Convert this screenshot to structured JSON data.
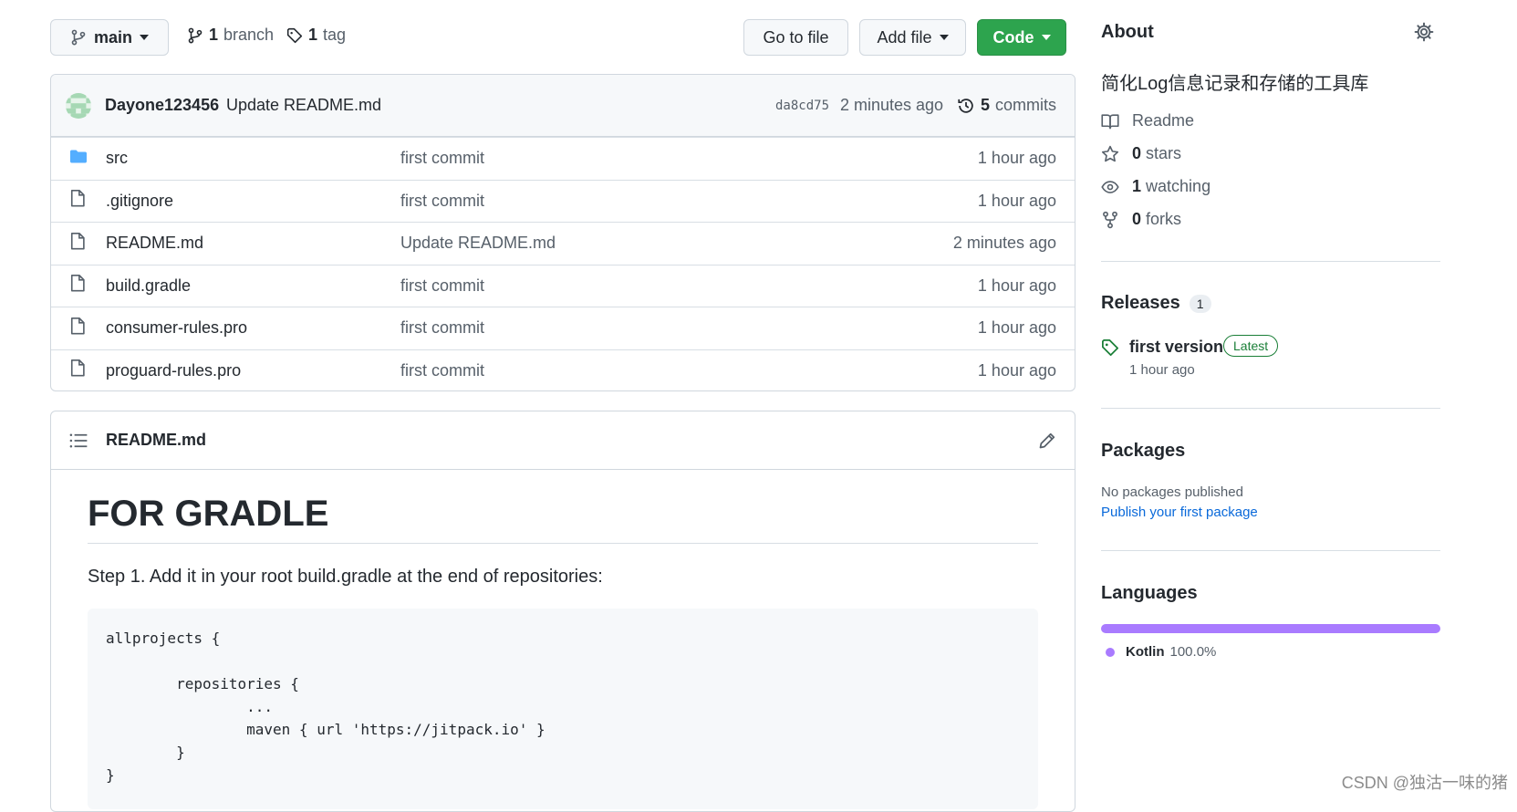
{
  "toolbar": {
    "branch_button": "main",
    "branch_count": "1",
    "branch_label": "branch",
    "tag_count": "1",
    "tag_label": "tag",
    "go_to_file": "Go to file",
    "add_file": "Add file",
    "code": "Code"
  },
  "commit": {
    "author": "Dayone123456",
    "message": "Update README.md",
    "sha": "da8cd75",
    "time": "2 minutes ago",
    "count": "5",
    "count_label": "commits"
  },
  "files": [
    {
      "name": "src",
      "message": "first commit",
      "age": "1 hour ago",
      "icon": "folder-icon"
    },
    {
      "name": ".gitignore",
      "message": "first commit",
      "age": "1 hour ago",
      "icon": "file-icon"
    },
    {
      "name": "README.md",
      "message": "Update README.md",
      "age": "2 minutes ago",
      "icon": "file-icon"
    },
    {
      "name": "build.gradle",
      "message": "first commit",
      "age": "1 hour ago",
      "icon": "file-icon"
    },
    {
      "name": "consumer-rules.pro",
      "message": "first commit",
      "age": "1 hour ago",
      "icon": "file-icon"
    },
    {
      "name": "proguard-rules.pro",
      "message": "first commit",
      "age": "1 hour ago",
      "icon": "file-icon"
    }
  ],
  "readme": {
    "filename": "README.md",
    "heading": "FOR GRADLE",
    "step1": "Step 1. Add it in your root build.gradle at the end of repositories:",
    "code": "allprojects {\n\n        repositories {\n                ...\n                maven { url 'https://jitpack.io' }\n        }\n}"
  },
  "about": {
    "title": "About",
    "description": "简化Log信息记录和存储的工具库",
    "readme": "Readme",
    "stars_count": "0",
    "stars_label": "stars",
    "watching_count": "1",
    "watching_label": "watching",
    "forks_count": "0",
    "forks_label": "forks"
  },
  "releases": {
    "title": "Releases",
    "count": "1",
    "name": "first version",
    "badge": "Latest",
    "time": "1 hour ago"
  },
  "packages": {
    "title": "Packages",
    "empty": "No packages published",
    "link": "Publish your first package"
  },
  "languages": {
    "title": "Languages",
    "name": "Kotlin",
    "percent": "100.0%",
    "color": "#a97bff"
  },
  "watermark": "CSDN @独沽一味的猪"
}
